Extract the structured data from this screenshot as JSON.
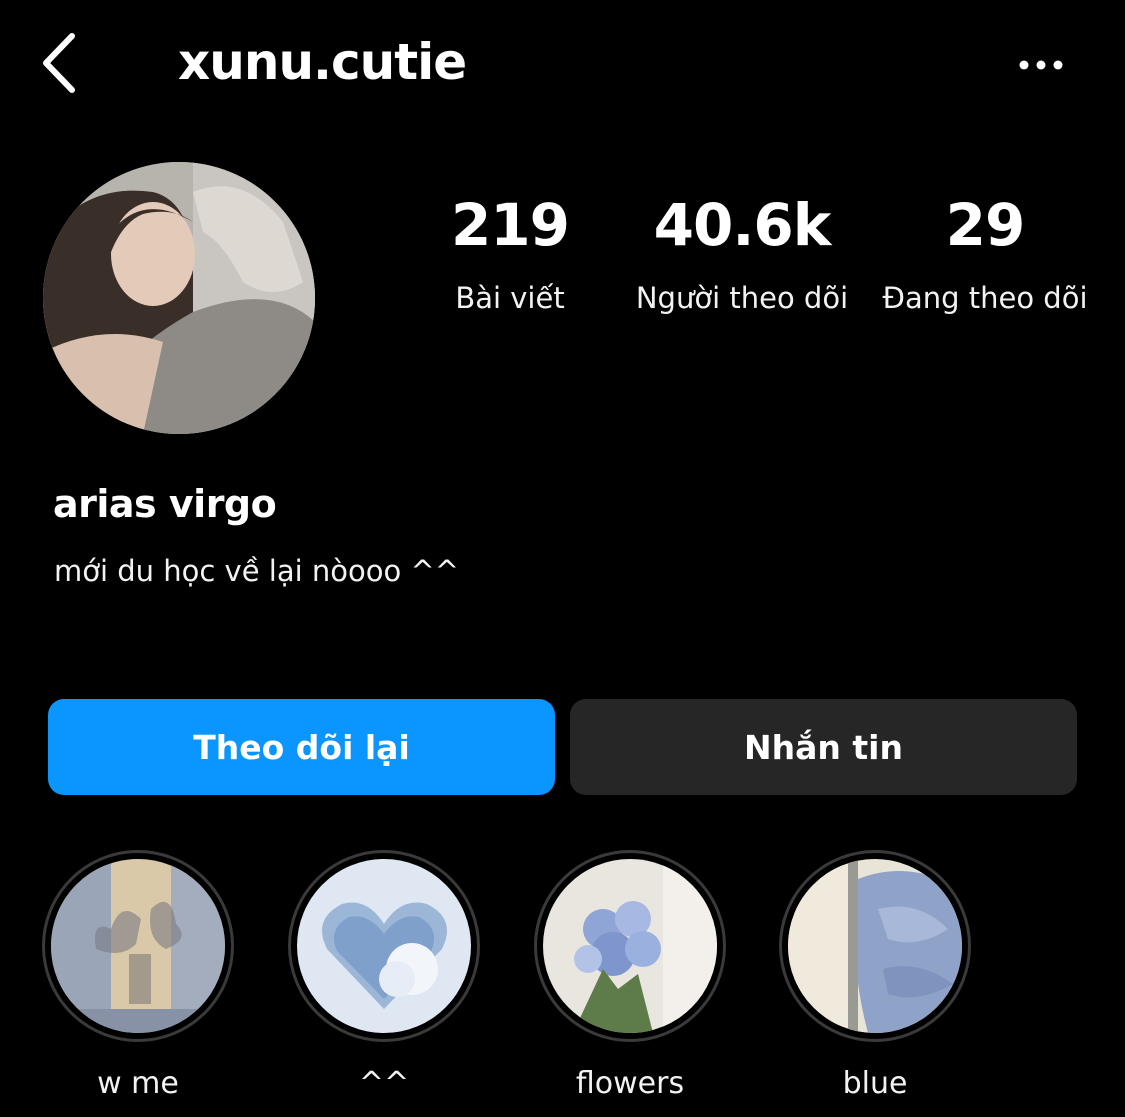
{
  "header": {
    "username": "xunu.cutie",
    "back_icon": "chevron-left-icon",
    "more_icon": "more-horizontal-icon"
  },
  "profile": {
    "display_name": "arias virgo",
    "bio": "mới du học về lại nòooo ^^"
  },
  "stats": {
    "posts": {
      "value": "219",
      "label": "Bài viết"
    },
    "followers": {
      "value": "40.6k",
      "label": "Người theo dõi"
    },
    "following": {
      "value": "29",
      "label": "Đang theo dõi"
    }
  },
  "actions": {
    "follow_back_label": "Theo dõi lại",
    "message_label": "Nhắn tin",
    "follow_back_color": "#0a95ff",
    "message_color": "#262626"
  },
  "highlights": [
    {
      "label": "w me"
    },
    {
      "label": "^^"
    },
    {
      "label": "flowers"
    },
    {
      "label": "blue"
    }
  ]
}
